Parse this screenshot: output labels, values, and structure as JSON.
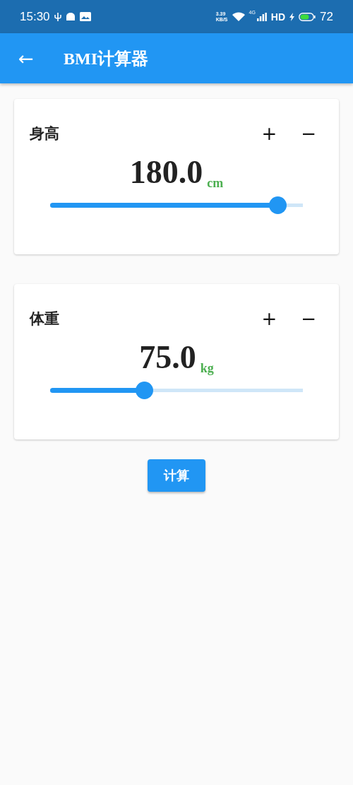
{
  "status_bar": {
    "time": "15:30",
    "speed": "3.39",
    "speed_unit": "KB/S",
    "network": "4G",
    "hd": "HD",
    "battery": "72"
  },
  "app_bar": {
    "back": "←",
    "title": "BMI计算器"
  },
  "cards": [
    {
      "label": "身高",
      "plus": "+",
      "minus": "−",
      "value": "180.0",
      "unit": "cm",
      "level": 0.9
    },
    {
      "label": "体重",
      "plus": "+",
      "minus": "−",
      "value": "75.0",
      "unit": "kg",
      "level": 0.374
    }
  ],
  "button": "计算"
}
